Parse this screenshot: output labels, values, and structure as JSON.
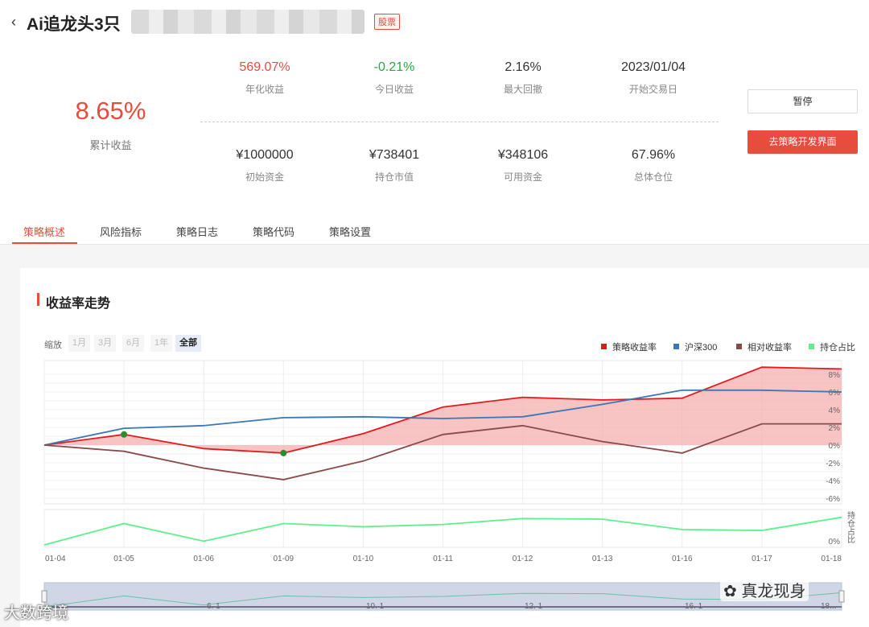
{
  "header": {
    "back_icon": "chevron-left-icon",
    "title": "Ai追龙头3只",
    "badge": "股票"
  },
  "summary": {
    "cumulative": {
      "value": "8.65%",
      "label": "累计收益"
    },
    "stats": [
      {
        "value": "569.07%",
        "label": "年化收益",
        "color": "#e74c3c"
      },
      {
        "value": "-0.21%",
        "label": "今日收益",
        "color": "#27a844"
      },
      {
        "value": "2.16%",
        "label": "最大回撤",
        "color": "#333333"
      },
      {
        "value": "2023/01/04",
        "label": "开始交易日",
        "color": "#333333"
      },
      {
        "value": "¥1000000",
        "label": "初始资金",
        "color": "#333333"
      },
      {
        "value": "¥738401",
        "label": "持仓市值",
        "color": "#333333"
      },
      {
        "value": "¥348106",
        "label": "可用资金",
        "color": "#333333"
      },
      {
        "value": "67.96%",
        "label": "总体仓位",
        "color": "#333333"
      }
    ],
    "pause_button": "暂停",
    "dev_button": "去策略开发界面"
  },
  "tabs": [
    "策略概述",
    "风险指标",
    "策略日志",
    "策略代码",
    "策略设置"
  ],
  "section": {
    "title": "收益率走势"
  },
  "zoom": {
    "label": "缩放",
    "options": [
      "1月",
      "3月",
      "6月",
      "1年",
      "全部"
    ],
    "active": "全部"
  },
  "legend": [
    {
      "name": "策略收益率",
      "color": "#e31a1c"
    },
    {
      "name": "沪深300",
      "color": "#3a78b6"
    },
    {
      "name": "相对收益率",
      "color": "#8b4a4a"
    },
    {
      "name": "持仓占比",
      "color": "#5ef08a"
    }
  ],
  "chart_data": {
    "type": "line",
    "x": [
      "01-04",
      "01-05",
      "01-06",
      "01-09",
      "01-10",
      "01-11",
      "01-12",
      "01-13",
      "01-16",
      "01-17",
      "01-18"
    ],
    "y_ticks": [
      "8%",
      "6%",
      "4%",
      "2%",
      "0%",
      "-2%",
      "-4%",
      "-6%"
    ],
    "ylim": [
      -6,
      8
    ],
    "series": [
      {
        "name": "策略收益率",
        "values": [
          0.0,
          1.2,
          -0.4,
          -0.9,
          1.3,
          4.3,
          5.4,
          5.1,
          5.3,
          8.8,
          8.6
        ],
        "fill": true
      },
      {
        "name": "沪深300",
        "values": [
          0.0,
          1.9,
          2.2,
          3.1,
          3.2,
          3.0,
          3.2,
          4.6,
          6.2,
          6.2,
          6.0
        ]
      },
      {
        "name": "相对收益率",
        "values": [
          0.0,
          -0.7,
          -2.6,
          -3.9,
          -1.8,
          1.2,
          2.2,
          0.4,
          -0.9,
          2.4,
          2.4
        ]
      }
    ],
    "markers": [
      {
        "series": "策略收益率",
        "x": "01-05",
        "value": 1.2
      },
      {
        "series": "策略收益率",
        "x": "01-09",
        "value": -0.9
      }
    ],
    "position": {
      "name": "持仓占比",
      "axis_label": "持仓占比",
      "tick": "0%",
      "values": [
        0,
        68,
        12,
        68,
        58,
        65,
        84,
        82,
        49,
        46,
        88
      ]
    },
    "navigator_ticks": [
      "6. 1",
      "10. 1",
      "12. 1",
      "16. 1",
      "18..."
    ]
  },
  "watermarks": {
    "right": "真龙现身",
    "left": "大数跨境"
  }
}
